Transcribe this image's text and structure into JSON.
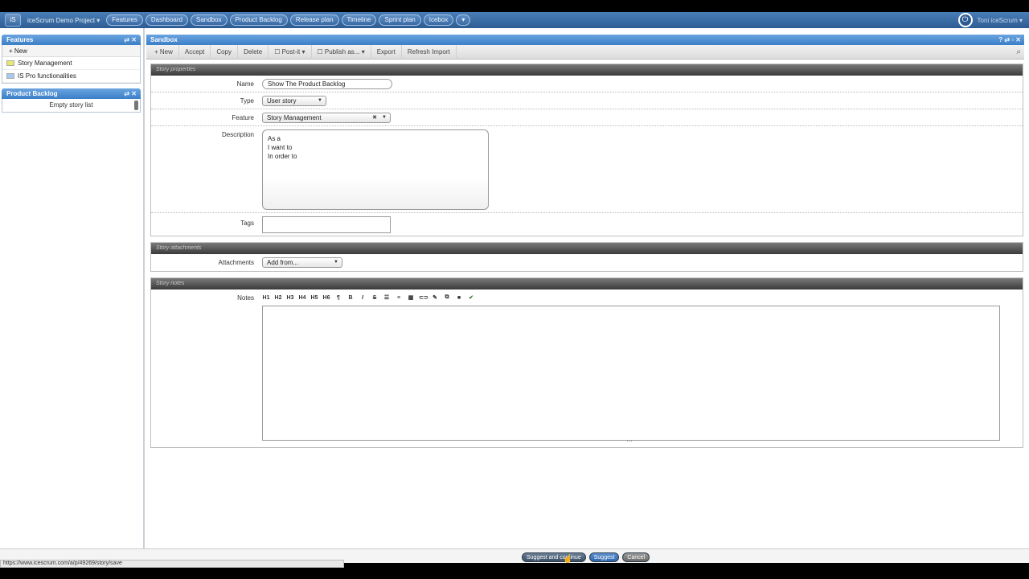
{
  "topbar": {
    "logo": "iS",
    "project": "iceScrum Demo Project ▾",
    "tabs": [
      "Features",
      "Dashboard",
      "Sandbox",
      "Product Backlog",
      "Release plan",
      "Timeline",
      "Sprint plan",
      "Icebox",
      "▾"
    ],
    "user": "Toni iceScrum ▾"
  },
  "left": {
    "features": {
      "title": "Features",
      "controls": "⇄ ✕",
      "new_label": "+ New",
      "items": [
        {
          "label": "Story Management",
          "color": "#e8e870"
        },
        {
          "label": "IS Pro functionalities",
          "color": "#a8c8f0"
        }
      ]
    },
    "backlog": {
      "title": "Product Backlog",
      "controls": "⇄ ✕",
      "empty": "Empty story list"
    }
  },
  "main": {
    "title": "Sandbox",
    "controls": "? ⇄ ▫ ✕",
    "toolbar": [
      "+ New",
      "Accept",
      "Copy",
      "Delete",
      "☐ Post-it ▾",
      "☐ Publish as... ▾",
      "Export",
      "Refresh Import"
    ],
    "properties": {
      "heading": "Story properties",
      "name_label": "Name",
      "name_value": "Show The Product Backlog",
      "type_label": "Type",
      "type_value": "User story",
      "feature_label": "Feature",
      "feature_value": "Story Management",
      "description_label": "Description",
      "description_lines": [
        "As a",
        "I want to",
        "In order to"
      ],
      "tags_label": "Tags"
    },
    "attachments": {
      "heading": "Story attachments",
      "label": "Attachments",
      "select_value": "Add from..."
    },
    "notes": {
      "heading": "Story notes",
      "label": "Notes",
      "tools": [
        "H1",
        "H2",
        "H3",
        "H4",
        "H5",
        "H6",
        "¶",
        "B",
        "I",
        "S",
        "☰",
        "≡",
        "▦",
        "⊂⊃",
        "✎",
        "⧉",
        "■",
        "✔"
      ]
    }
  },
  "footer": {
    "status_url": "https://www.icescrum.com/a/p/49269/story/save",
    "suggest_continue": "Suggest and continue",
    "suggest": "Suggest",
    "cancel": "Cancel"
  }
}
